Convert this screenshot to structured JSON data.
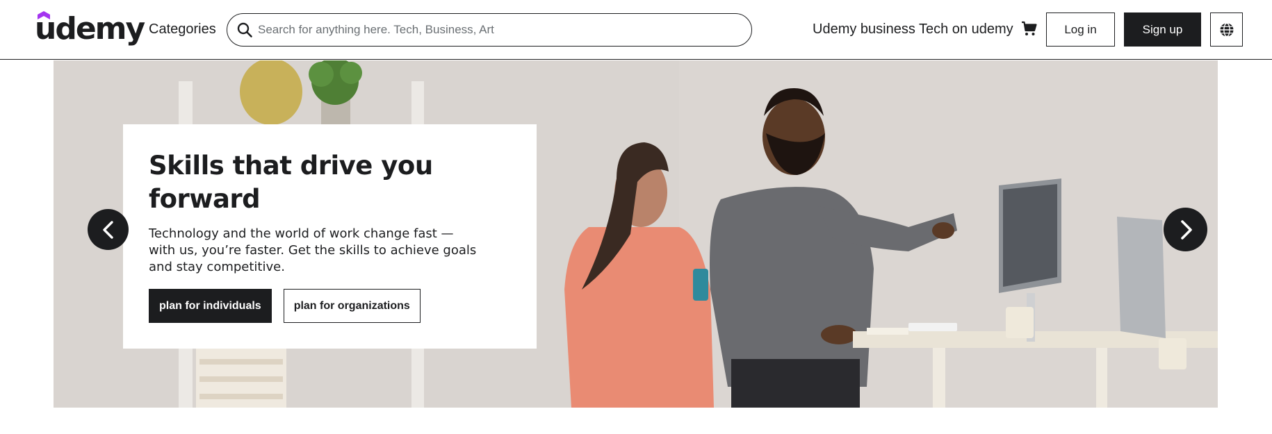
{
  "brand": {
    "name": "udemy",
    "accent": "#a435f0"
  },
  "header": {
    "categories_label": "Categories",
    "search": {
      "placeholder": "Search for anything here. Tech, Business, Art",
      "value": "",
      "icon": "search-icon"
    },
    "udemy_business_label": "Udemy business",
    "tech_on_udemy_label": "Tech on udemy",
    "cart_icon": "cart-icon",
    "login_label": "Log in",
    "signup_label": "Sign up",
    "language_icon": "globe-icon"
  },
  "hero": {
    "title": "Skills that drive you forward",
    "body": "Technology and the world of work change fast — with us, you’re faster. Get the skills to achieve goals and stay competitive.",
    "primary_button": "plan for individuals",
    "secondary_button": "plan for organizations",
    "prev_icon": "chevron-left-icon",
    "next_icon": "chevron-right-icon"
  },
  "colors": {
    "text": "#1c1d1f",
    "background": "#ffffff",
    "hero_background": "#dcd7d3"
  }
}
